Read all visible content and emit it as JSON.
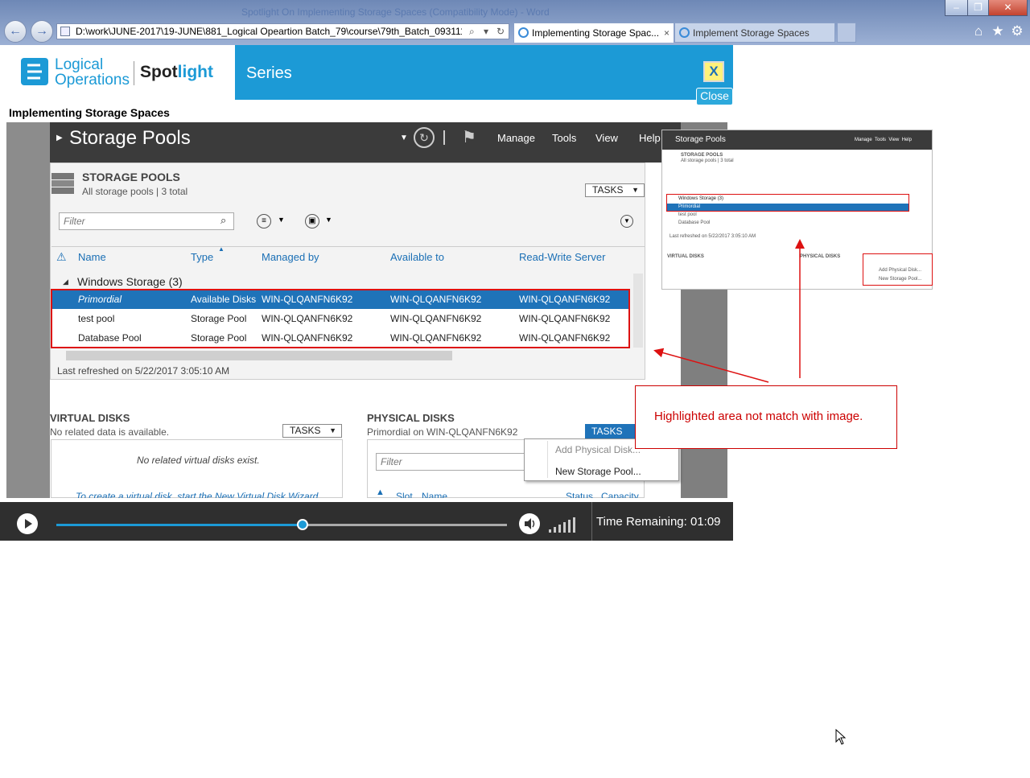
{
  "browser": {
    "window_title": "Spotlight On Implementing Storage Spaces (Compatibility Mode) - Word",
    "address": "D:\\work\\JUNE-2017\\19-JUNE\\881_Logical Opeartion Batch_79\\course\\79th_Batch_093111\\09",
    "tabs": [
      {
        "label": "Implementing Storage Spac...",
        "close": "×"
      },
      {
        "label": "Implement Storage Spaces"
      }
    ],
    "nav": {
      "back": "←",
      "forward": "→",
      "search": "⌕",
      "dropdown": "▾",
      "refresh": "↻"
    },
    "toolbar_icons": [
      "home-icon",
      "star-icon",
      "gear-icon"
    ],
    "window_controls": {
      "minimize": "–",
      "restore": "❐",
      "close": "✕"
    }
  },
  "spotlight": {
    "logo_line1": "Logical",
    "logo_line2": "Operations",
    "spot_a": "Spot",
    "spot_b": "light",
    "series": "Series",
    "close_x": "X",
    "close_label": "Close",
    "course_title": "Implementing Storage Spaces"
  },
  "server_manager": {
    "title": "Storage Pools",
    "menu": [
      "Manage",
      "Tools",
      "View",
      "Help"
    ],
    "pools": {
      "heading": "STORAGE POOLS",
      "subtitle": "All storage pools | 3 total",
      "tasks": "TASKS",
      "filter_placeholder": "Filter",
      "columns": [
        "Name",
        "Type",
        "Managed by",
        "Available to",
        "Read-Write Server"
      ],
      "group": "Windows Storage (3)",
      "rows": [
        {
          "name": "Primordial",
          "type": "Available Disks",
          "managed": "WIN-QLQANFN6K92",
          "available": "WIN-QLQANFN6K92",
          "rw": "WIN-QLQANFN6K92"
        },
        {
          "name": "test pool",
          "type": "Storage Pool",
          "managed": "WIN-QLQANFN6K92",
          "available": "WIN-QLQANFN6K92",
          "rw": "WIN-QLQANFN6K92"
        },
        {
          "name": "Database Pool",
          "type": "Storage Pool",
          "managed": "WIN-QLQANFN6K92",
          "available": "WIN-QLQANFN6K92",
          "rw": "WIN-QLQANFN6K92"
        }
      ],
      "last_refreshed": "Last refreshed on 5/22/2017 3:05:10 AM"
    },
    "virtual_disks": {
      "heading": "VIRTUAL DISKS",
      "subtitle": "No related data is available.",
      "tasks": "TASKS",
      "empty": "No related virtual disks exist.",
      "link": "To create a virtual disk, start the New Virtual Disk Wizard."
    },
    "physical_disks": {
      "heading": "PHYSICAL DISKS",
      "subtitle": "Primordial on WIN-QLQANFN6K92",
      "tasks": "TASKS",
      "filter_placeholder": "Filter",
      "columns": [
        "Slot",
        "Name",
        "Status",
        "Capacity"
      ]
    },
    "context_menu": [
      "Add Physical Disk...",
      "New Storage Pool..."
    ]
  },
  "player": {
    "time_remaining": "Time Remaining: 01:09",
    "progress": 0.546
  },
  "annotation": {
    "callout": "Highlighted area not match with image."
  }
}
